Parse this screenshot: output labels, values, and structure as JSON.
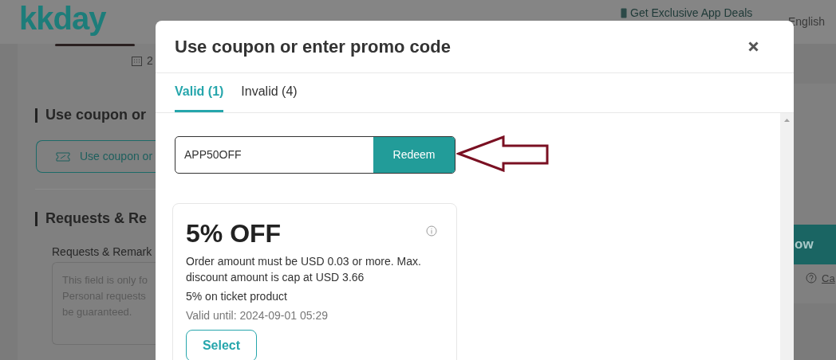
{
  "header": {
    "logo": "kkday",
    "app_deals": "Get Exclusive App Deals",
    "language": "English"
  },
  "background_page": {
    "date_fragment": "2",
    "coupon_section_title": "Use coupon or",
    "coupon_button": "Use coupon or",
    "requests_title": "Requests & Re",
    "requests_label": "Requests & Remark",
    "requests_placeholder_lines": [
      "This field is only fo",
      "Personal requests",
      "be guaranteed."
    ],
    "book_button": "ow",
    "help_link": "Ca"
  },
  "modal": {
    "title": "Use coupon or enter promo code",
    "tabs": [
      {
        "label": "Valid (1)",
        "selected": true
      },
      {
        "label": "Invalid (4)",
        "selected": false
      }
    ],
    "promo": {
      "value": "APP50OFF",
      "button": "Redeem"
    },
    "coupons": [
      {
        "title": "5% OFF",
        "terms": "Order amount must be USD 0.03 or more. Max. discount amount is cap at USD 3.66",
        "scope": "5% on ticket product",
        "valid_until": "Valid until: 2024-09-01 05:29",
        "button": "Select"
      }
    ]
  }
}
